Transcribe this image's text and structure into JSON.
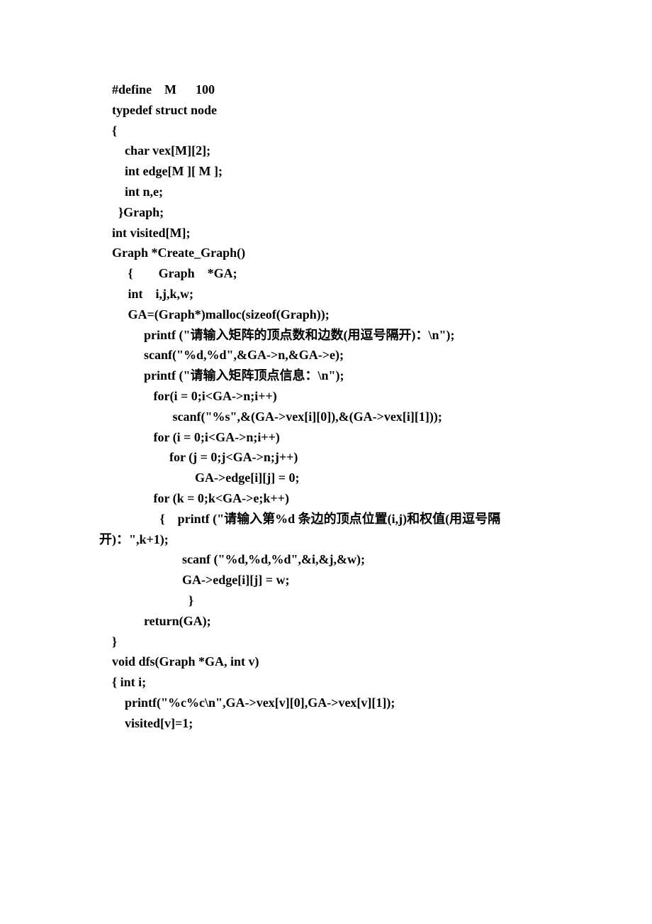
{
  "lines": [
    "    #define    M      100",
    "    typedef struct node",
    "    {",
    "        char vex[M][2];",
    "        int edge[M ][ M ];",
    "        int n,e;",
    "      }Graph;",
    "",
    "    int visited[M];",
    "",
    "    Graph *Create_Graph()",
    "         {        Graph    *GA;",
    "         int    i,j,k,w;",
    "         GA=(Graph*)malloc(sizeof(Graph));",
    "",
    "              printf (\"请输入矩阵的顶点数和边数(用逗号隔开)：\\n\");",
    "              scanf(\"%d,%d\",&GA->n,&GA->e);",
    "              printf (\"请输入矩阵顶点信息：\\n\");",
    "                 for(i = 0;i<GA->n;i++)",
    "                       scanf(\"%s\",&(GA->vex[i][0]),&(GA->vex[i][1]));",
    "                 for (i = 0;i<GA->n;i++)",
    "                      for (j = 0;j<GA->n;j++)",
    "                              GA->edge[i][j] = 0;",
    "                 for (k = 0;k<GA->e;k++)",
    "                   {    printf (\"请输入第%d 条边的顶点位置(i,j)和权值(用逗号隔",
    "开)：\",k+1);",
    "                          scanf (\"%d,%d,%d\",&i,&j,&w);",
    "                          GA->edge[i][j] = w;",
    "                            }",
    "              return(GA);",
    "    }",
    "",
    "",
    "    void dfs(Graph *GA, int v)",
    "    { int i;",
    "",
    "        printf(\"%c%c\\n\",GA->vex[v][0],GA->vex[v][1]);",
    "        visited[v]=1;"
  ]
}
